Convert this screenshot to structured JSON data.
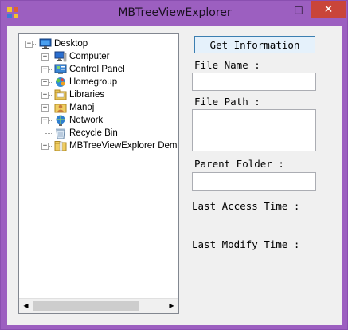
{
  "window": {
    "title": "MBTreeViewExplorer",
    "minimize_glyph": "—",
    "maximize_glyph": "□",
    "close_glyph": "✕",
    "close_color": "#c9453a",
    "frame_color": "#9c5fc0"
  },
  "tree": {
    "root": {
      "label": "Desktop",
      "icon": "desktop-icon",
      "expanded": true
    },
    "children": [
      {
        "label": "Computer",
        "icon": "computer-icon",
        "expandable": true
      },
      {
        "label": "Control Panel",
        "icon": "control-panel-icon",
        "expandable": true
      },
      {
        "label": "Homegroup",
        "icon": "homegroup-icon",
        "expandable": true
      },
      {
        "label": "Libraries",
        "icon": "libraries-icon",
        "expandable": true
      },
      {
        "label": "Manoj",
        "icon": "user-folder-icon",
        "expandable": true
      },
      {
        "label": "Network",
        "icon": "network-icon",
        "expandable": true
      },
      {
        "label": "Recycle Bin",
        "icon": "recycle-bin-icon",
        "expandable": false
      },
      {
        "label": "MBTreeViewExplorer Demo",
        "icon": "folder-icon",
        "expandable": true
      }
    ],
    "expander_collapsed": "+",
    "expander_expanded": "−"
  },
  "scrollbar": {
    "left_arrow": "◀",
    "right_arrow": "▶"
  },
  "panel": {
    "get_info_button": "Get Information",
    "file_name_label": "File Name :",
    "file_name_value": "",
    "file_path_label": "File Path :",
    "file_path_value": "",
    "parent_folder_label": "Parent Folder :",
    "parent_folder_value": "",
    "last_access_label": "Last Access Time :",
    "last_access_value": "",
    "last_modify_label": "Last Modify Time :",
    "last_modify_value": ""
  }
}
